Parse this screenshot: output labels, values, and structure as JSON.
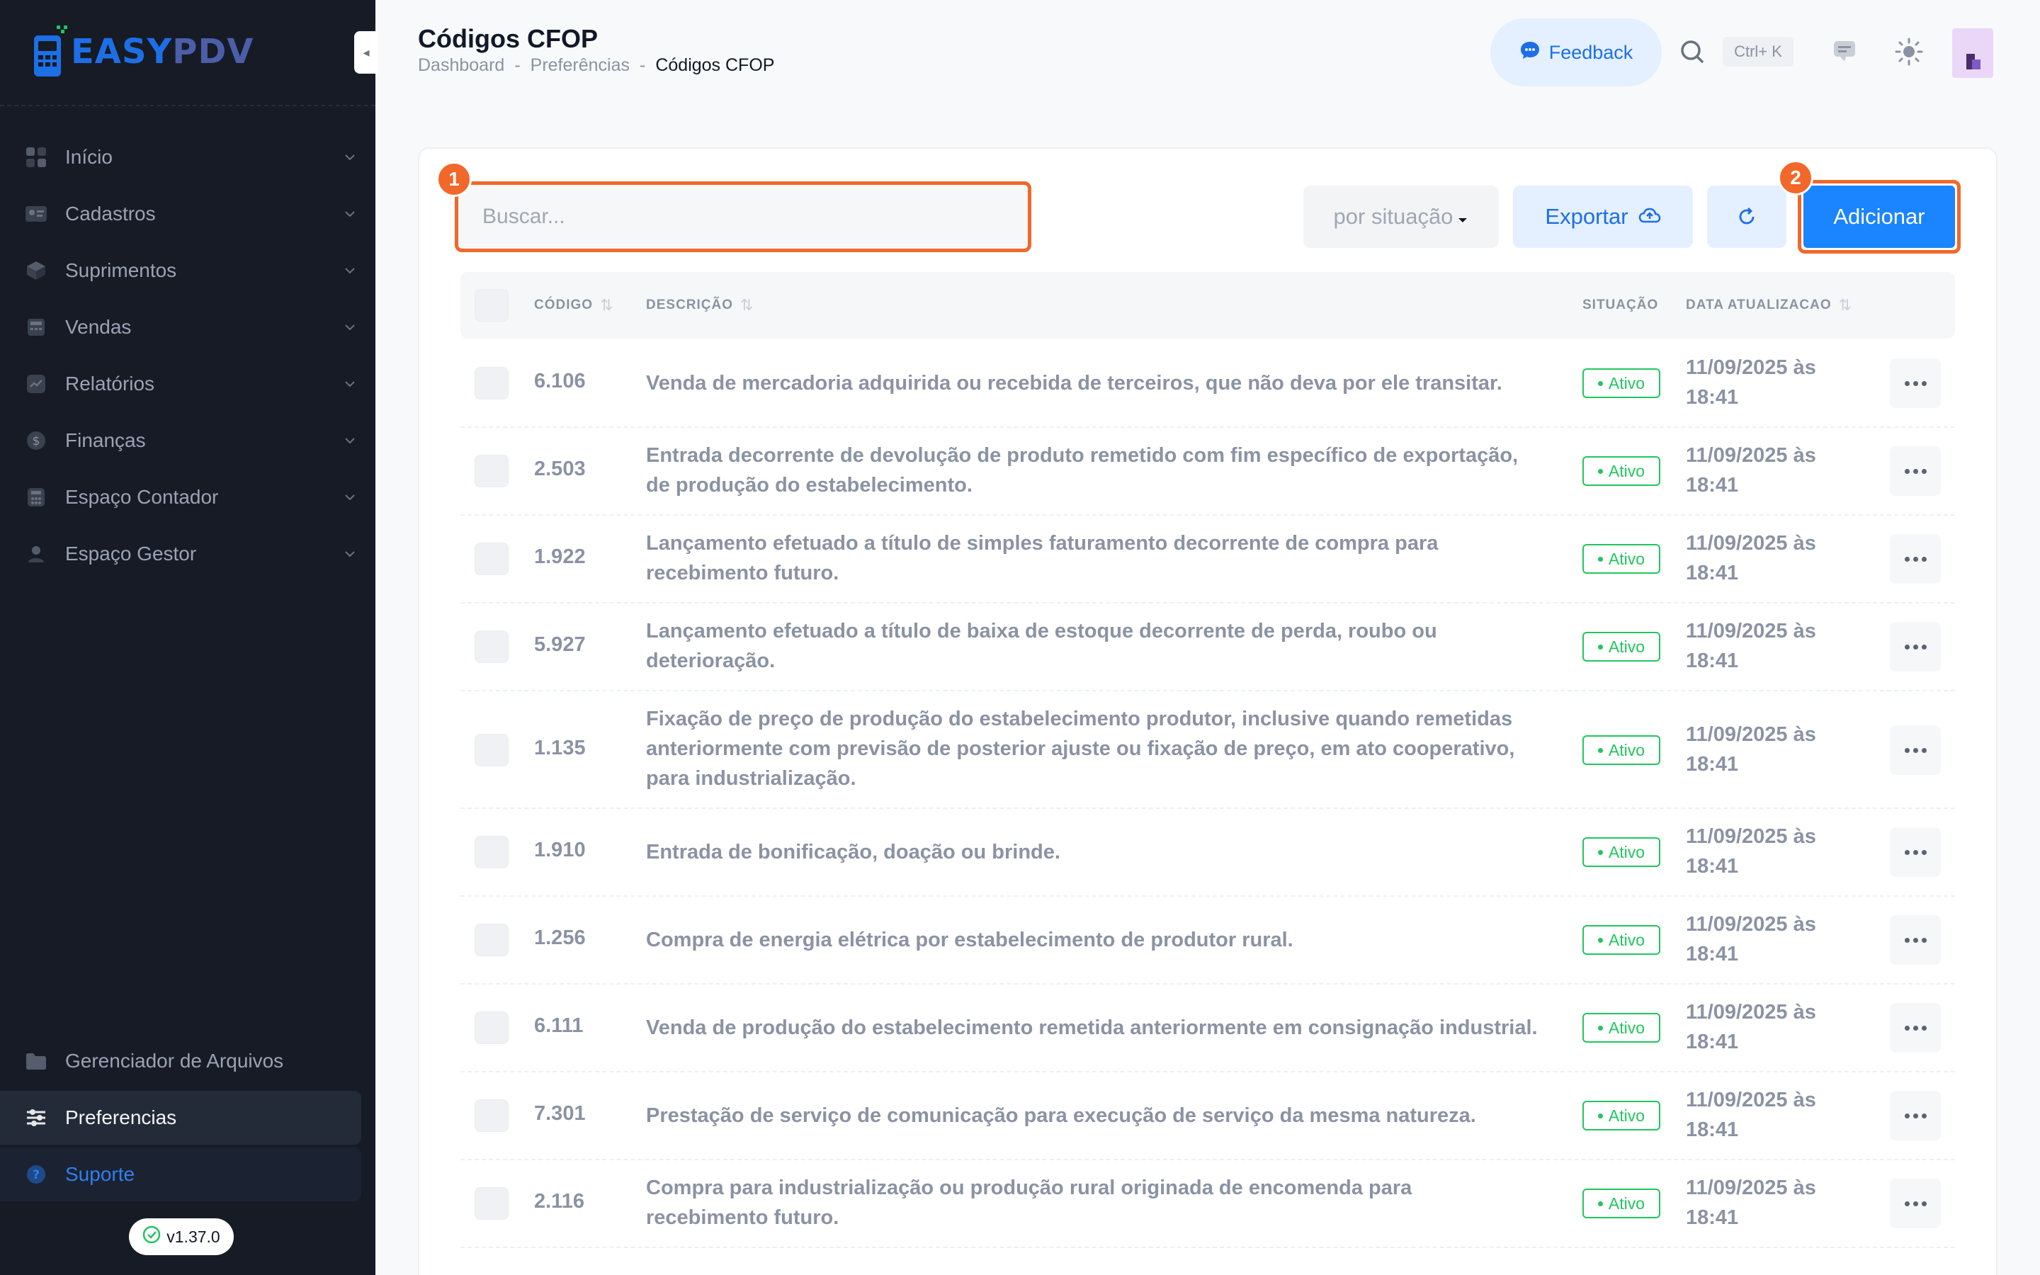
{
  "app": {
    "logo_text_a": "EASY",
    "logo_text_b": "PDV",
    "version": "v1.37.0"
  },
  "sidebar": {
    "items": [
      {
        "label": "Início",
        "icon": "grid-icon"
      },
      {
        "label": "Cadastros",
        "icon": "id-card-icon"
      },
      {
        "label": "Suprimentos",
        "icon": "box-icon"
      },
      {
        "label": "Vendas",
        "icon": "register-icon"
      },
      {
        "label": "Relatórios",
        "icon": "chart-icon"
      },
      {
        "label": "Finanças",
        "icon": "dollar-icon"
      },
      {
        "label": "Espaço Contador",
        "icon": "calculator-icon"
      },
      {
        "label": "Espaço Gestor",
        "icon": "user-icon"
      }
    ],
    "bottom": [
      {
        "label": "Gerenciador de Arquivos",
        "icon": "folder-icon"
      },
      {
        "label": "Preferencias",
        "icon": "sliders-icon"
      },
      {
        "label": "Suporte",
        "icon": "help-icon"
      }
    ]
  },
  "header": {
    "title": "Códigos CFOP",
    "breadcrumb": [
      "Dashboard",
      "Preferências",
      "Códigos CFOP"
    ],
    "breadcrumb_sep": "-",
    "feedback": "Feedback",
    "shortcut": "Ctrl+ K"
  },
  "toolbar": {
    "search_placeholder": "Buscar...",
    "filter": "por situação",
    "export": "Exportar",
    "add": "Adicionar",
    "step1": "1",
    "step2": "2"
  },
  "table": {
    "columns": {
      "code": "CÓDIGO",
      "description": "DESCRIÇÃO",
      "status": "SITUAÇÃO",
      "updated": "DATA ATUALIZACAO"
    },
    "rows": [
      {
        "code": "6.106",
        "desc": "Venda de mercadoria adquirida ou recebida de terceiros, que não deva por ele transitar.",
        "status": "Ativo",
        "date1": "11/09/2025 às",
        "date2": "18:41"
      },
      {
        "code": "2.503",
        "desc": "Entrada decorrente de devolução de produto remetido com fim específico de exportação, de produção do estabelecimento.",
        "status": "Ativo",
        "date1": "11/09/2025 às",
        "date2": "18:41"
      },
      {
        "code": "1.922",
        "desc": "Lançamento efetuado a título de simples faturamento decorrente de compra para recebimento futuro.",
        "status": "Ativo",
        "date1": "11/09/2025 às",
        "date2": "18:41"
      },
      {
        "code": "5.927",
        "desc": "Lançamento efetuado a título de baixa de estoque decorrente de perda, roubo ou deterioração.",
        "status": "Ativo",
        "date1": "11/09/2025 às",
        "date2": "18:41"
      },
      {
        "code": "1.135",
        "desc": "Fixação de preço de produção do estabelecimento produtor, inclusive quando remetidas anteriormente com previsão de posterior ajuste ou fixação de preço, em ato cooperativo, para industrialização.",
        "status": "Ativo",
        "date1": "11/09/2025 às",
        "date2": "18:41"
      },
      {
        "code": "1.910",
        "desc": "Entrada de bonificação, doação ou brinde.",
        "status": "Ativo",
        "date1": "11/09/2025 às",
        "date2": "18:41"
      },
      {
        "code": "1.256",
        "desc": "Compra de energia elétrica por estabelecimento de produtor rural.",
        "status": "Ativo",
        "date1": "11/09/2025 às",
        "date2": "18:41"
      },
      {
        "code": "6.111",
        "desc": "Venda de produção do estabelecimento remetida anteriormente em consignação industrial.",
        "status": "Ativo",
        "date1": "11/09/2025 às",
        "date2": "18:41"
      },
      {
        "code": "7.301",
        "desc": "Prestação de serviço de comunicação para execução de serviço da mesma natureza.",
        "status": "Ativo",
        "date1": "11/09/2025 às",
        "date2": "18:41"
      },
      {
        "code": "2.116",
        "desc": "Compra para industrialização ou produção rural originada de encomenda para recebimento futuro.",
        "status": "Ativo",
        "date1": "11/09/2025 às",
        "date2": "18:41"
      }
    ]
  },
  "colors": {
    "accent": "#1b84ff",
    "highlight": "#f2672a",
    "success": "#22c55e",
    "sidebar_bg": "#161b26"
  }
}
